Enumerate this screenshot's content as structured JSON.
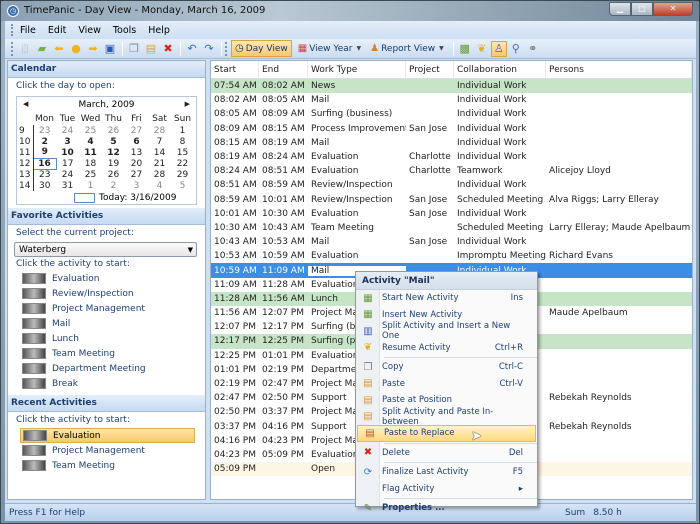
{
  "window": {
    "title": "TimePanic - Day View - Monday, March 16, 2009"
  },
  "menu": [
    "File",
    "Edit",
    "View",
    "Tools",
    "Help"
  ],
  "toolbar": {
    "icons": [
      "new-icon",
      "open-icon",
      "back-icon",
      "today-icon",
      "forward-icon",
      "save-icon",
      "copy-icon",
      "paste-icon",
      "delete-icon",
      "undo-icon",
      "redo-icon"
    ],
    "views": [
      {
        "label": "Day View",
        "active": true
      },
      {
        "label": "View Year",
        "dropdown": true
      },
      {
        "label": "Report View",
        "dropdown": true
      }
    ]
  },
  "calendar": {
    "header": "Calendar",
    "hint": "Click the day to open:",
    "month": "March, 2009",
    "weekdays": [
      "Mon",
      "Tue",
      "Wed",
      "Thu",
      "Fri",
      "Sat",
      "Sun"
    ],
    "weeks": [
      {
        "wk": "9",
        "days": [
          "23",
          "24",
          "25",
          "26",
          "27",
          "28",
          "1"
        ]
      },
      {
        "wk": "10",
        "days": [
          "2",
          "3",
          "4",
          "5",
          "6",
          "7",
          "8"
        ]
      },
      {
        "wk": "11",
        "days": [
          "9",
          "10",
          "11",
          "12",
          "13",
          "14",
          "15"
        ]
      },
      {
        "wk": "12",
        "days": [
          "16",
          "17",
          "18",
          "19",
          "20",
          "21",
          "22"
        ]
      },
      {
        "wk": "13",
        "days": [
          "23",
          "24",
          "25",
          "26",
          "27",
          "28",
          "29"
        ]
      },
      {
        "wk": "14",
        "days": [
          "30",
          "31",
          "1",
          "2",
          "3",
          "4",
          "5"
        ]
      }
    ],
    "today": "Today: 3/16/2009",
    "selected": "16"
  },
  "favorites": {
    "header": "Favorite Activities",
    "project_hint": "Select the current project:",
    "project": "Waterberg",
    "activity_hint": "Click the activity to start:",
    "activities": [
      "Evaluation",
      "Review/Inspection",
      "Project Management",
      "Mail",
      "Lunch",
      "Team Meeting",
      "Department Meeting",
      "Break"
    ]
  },
  "recent": {
    "header": "Recent Activities",
    "hint": "Click the activity to start:",
    "activities": [
      "Evaluation",
      "Project Management",
      "Team Meeting"
    ]
  },
  "grid": {
    "columns": [
      "Start",
      "End",
      "Work Type",
      "Project",
      "Collaboration",
      "Persons"
    ],
    "rows": [
      [
        "07:54 AM",
        "08:02 AM",
        "News",
        "",
        "Individual Work",
        ""
      ],
      [
        "08:02 AM",
        "08:05 AM",
        "Mail",
        "",
        "Individual Work",
        ""
      ],
      [
        "08:05 AM",
        "08:09 AM",
        "Surfing (business)",
        "",
        "Individual Work",
        ""
      ],
      [
        "08:09 AM",
        "08:15 AM",
        "Process Improvement",
        "San Jose",
        "Individual Work",
        ""
      ],
      [
        "08:15 AM",
        "08:19 AM",
        "Mail",
        "",
        "Individual Work",
        ""
      ],
      [
        "08:19 AM",
        "08:24 AM",
        "Evaluation",
        "Charlotte",
        "Individual Work",
        ""
      ],
      [
        "08:24 AM",
        "08:51 AM",
        "Evaluation",
        "Charlotte",
        "Teamwork",
        "Alicejoy Lloyd"
      ],
      [
        "08:51 AM",
        "08:59 AM",
        "Review/Inspection",
        "",
        "Individual Work",
        ""
      ],
      [
        "08:59 AM",
        "10:01 AM",
        "Review/Inspection",
        "San Jose",
        "Scheduled Meeting",
        "Alva Riggs; Larry Elleray"
      ],
      [
        "10:01 AM",
        "10:30 AM",
        "Evaluation",
        "San Jose",
        "Individual Work",
        ""
      ],
      [
        "10:30 AM",
        "10:43 AM",
        "Team Meeting",
        "",
        "Scheduled Meeting",
        "Larry Elleray; Maude Apelbaum"
      ],
      [
        "10:43 AM",
        "10:53 AM",
        "Mail",
        "San Jose",
        "Individual Work",
        ""
      ],
      [
        "10:53 AM",
        "10:59 AM",
        "Evaluation",
        "",
        "Impromptu Meeting",
        "Richard Evans"
      ],
      [
        "10:59 AM",
        "11:09 AM",
        "Mail",
        "",
        "Individual Work",
        ""
      ],
      [
        "11:09 AM",
        "11:28 AM",
        "Evaluation",
        "",
        "",
        ""
      ],
      [
        "11:28 AM",
        "11:56 AM",
        "Lunch",
        "",
        "",
        ""
      ],
      [
        "11:56 AM",
        "12:07 PM",
        "Project Management",
        "",
        "",
        "Maude Apelbaum"
      ],
      [
        "12:07 PM",
        "12:17 PM",
        "Surfing (business)",
        "",
        "",
        ""
      ],
      [
        "12:17 PM",
        "12:25 PM",
        "Surfing (private)",
        "",
        "",
        ""
      ],
      [
        "12:25 PM",
        "01:01 PM",
        "Evaluation",
        "",
        "",
        ""
      ],
      [
        "01:01 PM",
        "02:19 PM",
        "Department Meeting",
        "",
        "",
        ""
      ],
      [
        "02:19 PM",
        "02:47 PM",
        "Project Management",
        "",
        "",
        ""
      ],
      [
        "02:47 PM",
        "02:50 PM",
        "Support",
        "",
        "",
        "Rebekah Reynolds"
      ],
      [
        "02:50 PM",
        "03:37 PM",
        "Project Management",
        "",
        "",
        ""
      ],
      [
        "03:37 PM",
        "04:16 PM",
        "Support",
        "",
        "",
        "Rebekah Reynolds"
      ],
      [
        "04:16 PM",
        "04:23 PM",
        "Project Management",
        "",
        "",
        ""
      ],
      [
        "04:23 PM",
        "05:09 PM",
        "Evaluation",
        "",
        "",
        ""
      ],
      [
        "05:09 PM",
        "",
        "Open",
        "",
        "",
        ""
      ]
    ],
    "row_styles": [
      "green",
      "",
      "",
      "",
      "",
      "",
      "",
      "",
      "",
      "",
      "",
      "",
      "",
      "selected",
      "",
      "green",
      "",
      "",
      "green",
      "",
      "",
      "",
      "",
      "",
      "",
      "",
      "",
      "open"
    ]
  },
  "context_menu": {
    "title": "Activity \"Mail\"",
    "items": [
      {
        "label": "Start New Activity",
        "shortcut": "Ins",
        "icon": "start-activity-icon"
      },
      {
        "label": "Insert New Activity",
        "shortcut": "",
        "icon": "insert-activity-icon"
      },
      {
        "label": "Split Activity and Insert a New One",
        "shortcut": "",
        "icon": "split-activity-icon"
      },
      {
        "label": "Resume Activity",
        "shortcut": "Ctrl+R",
        "icon": "resume-icon"
      },
      {
        "sep": true
      },
      {
        "label": "Copy",
        "shortcut": "Ctrl-C",
        "icon": "copy-icon"
      },
      {
        "label": "Paste",
        "shortcut": "Ctrl-V",
        "icon": "paste-icon"
      },
      {
        "label": "Paste at Position",
        "shortcut": "",
        "icon": "paste-position-icon"
      },
      {
        "label": "Split Activity and Paste In-between",
        "shortcut": "",
        "icon": "split-paste-icon"
      },
      {
        "label": "Paste to Replace",
        "shortcut": "",
        "icon": "paste-replace-icon",
        "highlighted": true
      },
      {
        "sep": true
      },
      {
        "label": "Delete",
        "shortcut": "Del",
        "icon": "delete-icon"
      },
      {
        "sep": true
      },
      {
        "label": "Finalize Last Activity",
        "shortcut": "F5",
        "icon": "finalize-icon"
      },
      {
        "label": "Flag Activity",
        "shortcut": "▸",
        "icon": ""
      },
      {
        "sep": true
      },
      {
        "label": "Properties ...",
        "shortcut": "",
        "icon": "properties-icon",
        "bold": true
      }
    ]
  },
  "status": {
    "help": "Press F1 for Help",
    "sum_label": "Sum",
    "sum_value": "8.50 h"
  }
}
